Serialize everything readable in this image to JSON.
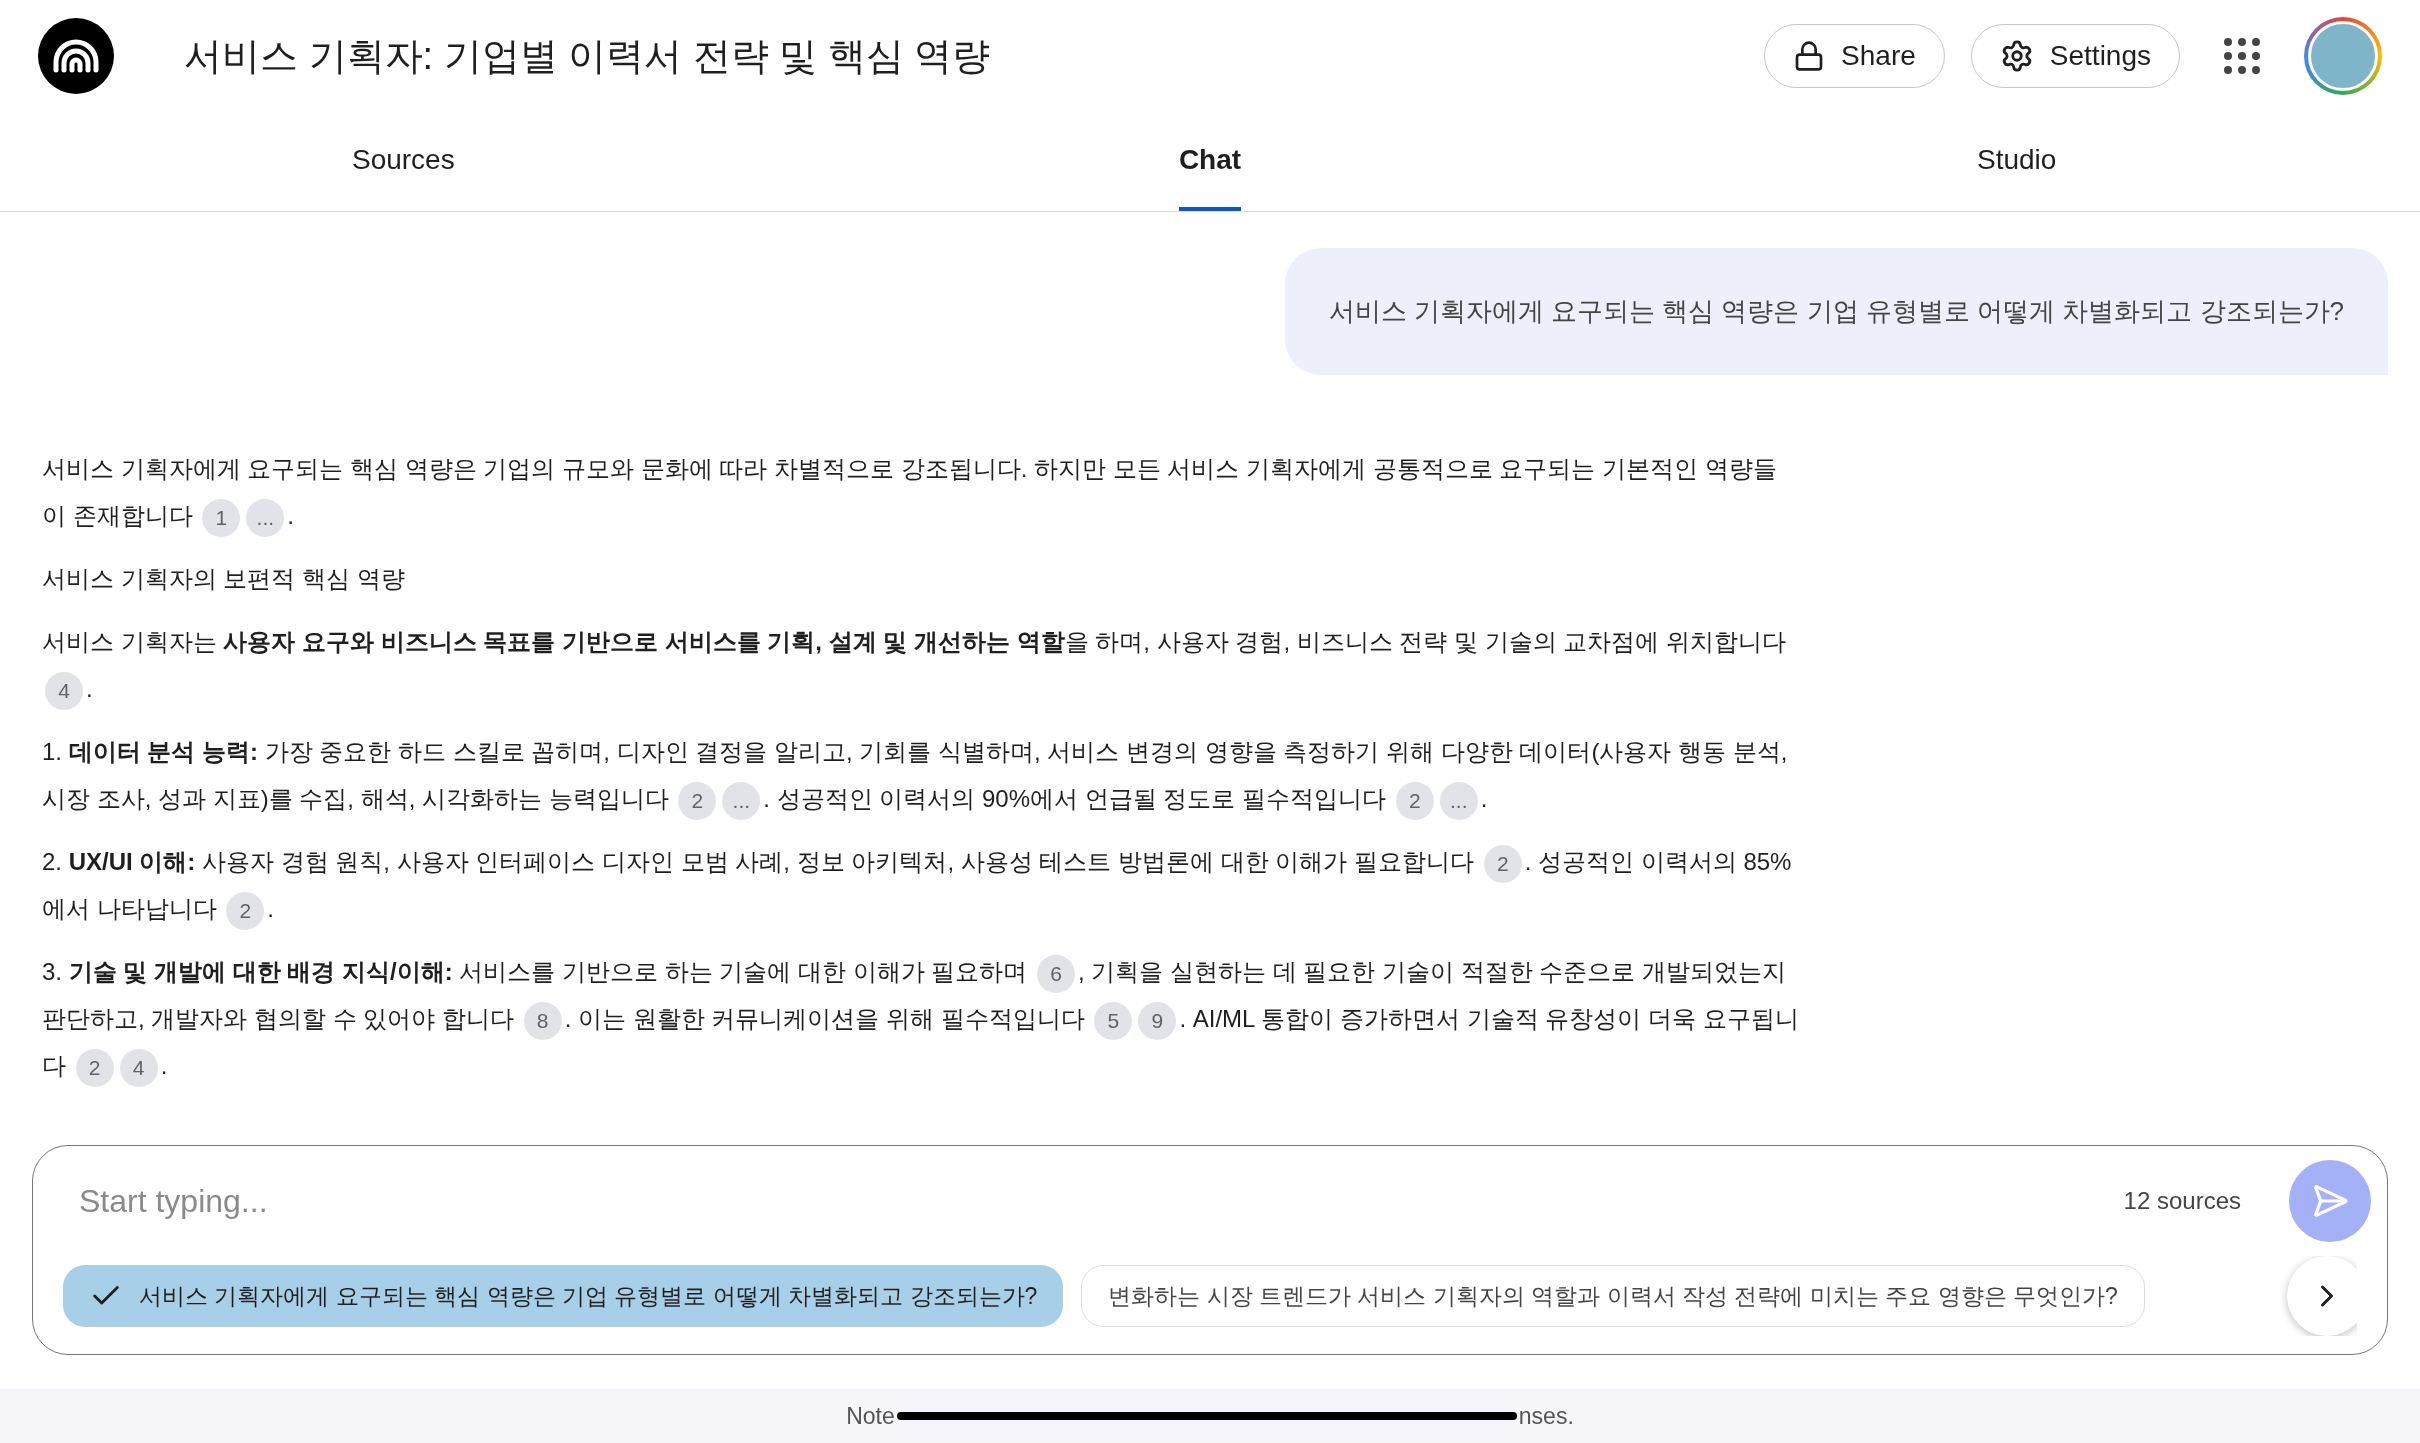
{
  "header": {
    "title": "서비스 기획자: 기업별 이력서 전략 및 핵심 역량",
    "share": "Share",
    "settings": "Settings"
  },
  "tabs": [
    {
      "label": "Sources",
      "selected": false
    },
    {
      "label": "Chat",
      "selected": true
    },
    {
      "label": "Studio",
      "selected": false
    }
  ],
  "user_message": "서비스 기획자에게 요구되는 핵심 역량은 기업 유형별로 어떻게 차별화되고 강조되는가?",
  "response": [
    {
      "parts": [
        {
          "text": "서비스 기획자에게 요구되는 핵심 역량은 기업의 규모와 문화에 따라 차별적으로 강조됩니다. 하지만 모든 서비스 기획자에게 공통적으로 요구되는 기본적인 역량들이 존재합니다 "
        },
        {
          "cite": "1"
        },
        {
          "cite": "..."
        },
        {
          "text": "."
        }
      ]
    },
    {
      "parts": [
        {
          "text": "서비스 기획자의 보편적 핵심 역량"
        }
      ]
    },
    {
      "parts": [
        {
          "text": "서비스 기획자는 **사용자 요구와 비즈니스 목표를 기반으로 서비스를 기획, 설계 및 개선하는 역할**을 하며, 사용자 경험, 비즈니스 전략 및 기술의 교차점에 위치합니다 "
        },
        {
          "cite": "4"
        },
        {
          "text": "."
        }
      ]
    },
    {
      "parts": [
        {
          "text": "1. **데이터 분석 능력:** 가장 중요한 하드 스킬로 꼽히며, 디자인 결정을 알리고, 기회를 식별하며, 서비스 변경의 영향을 측정하기 위해 다양한 데이터(사용자 행동 분석, 시장 조사, 성과 지표)를 수집, 해석, 시각화하는 능력입니다 "
        },
        {
          "cite": "2"
        },
        {
          "cite": "..."
        },
        {
          "text": ". 성공적인 이력서의 90%에서 언급될 정도로 필수적입니다 "
        },
        {
          "cite": "2"
        },
        {
          "cite": "..."
        },
        {
          "text": "."
        }
      ]
    },
    {
      "parts": [
        {
          "text": "2. **UX/UI 이해:** 사용자 경험 원칙, 사용자 인터페이스 디자인 모범 사례, 정보 아키텍처, 사용성 테스트 방법론에 대한 이해가 필요합니다 "
        },
        {
          "cite": "2"
        },
        {
          "text": ". 성공적인 이력서의 85%에서 나타납니다 "
        },
        {
          "cite": "2"
        },
        {
          "text": "."
        }
      ]
    },
    {
      "parts": [
        {
          "text": "3. **기술 및 개발에 대한 배경 지식/이해:** 서비스를 기반으로 하는 기술에 대한 이해가 필요하며 "
        },
        {
          "cite": "6"
        },
        {
          "text": ", 기획을 실현하는 데 필요한 기술이 적절한 수준으로 개발되었는지 판단하고, 개발자와 협의할 수 있어야 합니다 "
        },
        {
          "cite": "8"
        },
        {
          "text": ". 이는 원활한 커뮤니케이션을 위해 필수적입니다 "
        },
        {
          "cite": "5"
        },
        {
          "cite": "9"
        },
        {
          "text": ". AI/ML 통합이 증가하면서 기술적 유창성이 더욱 요구됩니다 "
        },
        {
          "cite": "2"
        },
        {
          "cite": "4"
        },
        {
          "text": "."
        }
      ]
    }
  ],
  "composer": {
    "placeholder": "Start typing...",
    "source_count": "12 sources"
  },
  "suggestions": [
    {
      "label": "서비스 기획자에게 요구되는 핵심 역량은 기업 유형별로 어떻게 차별화되고 강조되는가?",
      "selected": true
    },
    {
      "label": "변화하는 시장 트렌드가 서비스 기획자의 역할과 이력서 작성 전략에 미치는 주요 영향은 무엇인가?",
      "selected": false
    }
  ],
  "footer": {
    "start": "Note",
    "end": "nses."
  }
}
